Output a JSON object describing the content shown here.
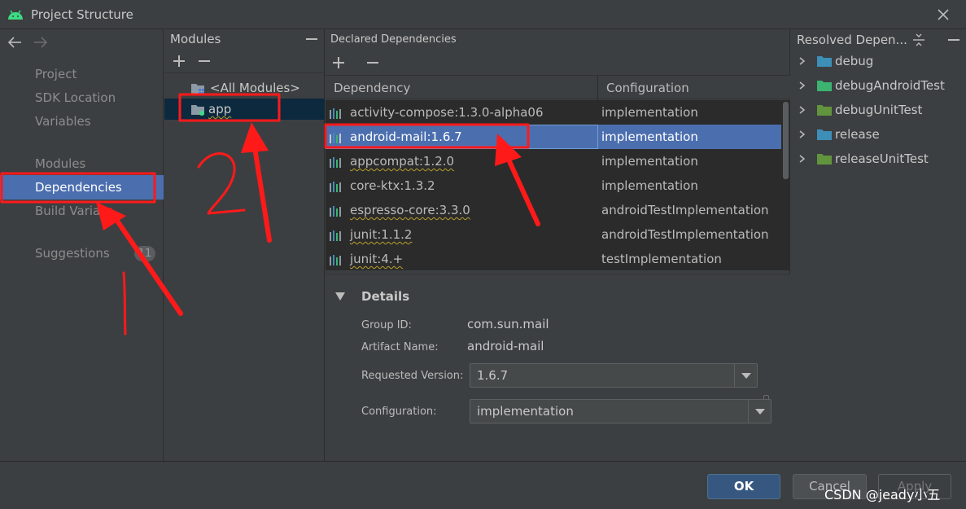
{
  "window": {
    "title": "Project Structure"
  },
  "nav": {
    "items": [
      {
        "label": "Project"
      },
      {
        "label": "SDK Location"
      },
      {
        "label": "Variables"
      },
      {
        "label": "Modules"
      },
      {
        "label": "Dependencies"
      },
      {
        "label": "Build Varian"
      },
      {
        "label": "Suggestions"
      }
    ],
    "selected": "Dependencies",
    "suggestions_count": "11"
  },
  "modules": {
    "header": "Modules",
    "items": [
      {
        "label": "<All Modules>"
      },
      {
        "label": "app"
      }
    ],
    "selected": "app"
  },
  "declared": {
    "header": "Declared Dependencies",
    "columns": {
      "dependency": "Dependency",
      "configuration": "Configuration"
    },
    "rows": [
      {
        "name": "activity-compose:1.3.0-alpha06",
        "configuration": "implementation"
      },
      {
        "name": "android-mail:1.6.7",
        "configuration": "implementation"
      },
      {
        "name": "appcompat:1.2.0",
        "configuration": "implementation"
      },
      {
        "name": "core-ktx:1.3.2",
        "configuration": "implementation"
      },
      {
        "name": "espresso-core:3.3.0",
        "configuration": "androidTestImplementation"
      },
      {
        "name": "junit:1.1.2",
        "configuration": "androidTestImplementation"
      },
      {
        "name": "junit:4.+",
        "configuration": "testImplementation"
      }
    ],
    "selected": "android-mail:1.6.7"
  },
  "details": {
    "title": "Details",
    "group_id_label": "Group ID:",
    "group_id": "com.sun.mail",
    "artifact_label": "Artifact Name:",
    "artifact": "android-mail",
    "version_label": "Requested Version:",
    "version": "1.6.7",
    "config_label": "Configuration:",
    "config": "implementation"
  },
  "resolved": {
    "header": "Resolved Depen...",
    "variants": [
      {
        "label": "debug",
        "color": "#3d8fb8"
      },
      {
        "label": "debugAndroidTest",
        "color": "#3cb371"
      },
      {
        "label": "debugUnitTest",
        "color": "#62943e"
      },
      {
        "label": "release",
        "color": "#3d8fb8"
      },
      {
        "label": "releaseUnitTest",
        "color": "#62943e"
      }
    ]
  },
  "buttons": {
    "ok": "OK",
    "cancel": "Cancel",
    "apply": "Apply"
  },
  "watermark": "CSDN @jeady小五",
  "annotation_colors": {
    "highlight": "#ff1a1a"
  }
}
